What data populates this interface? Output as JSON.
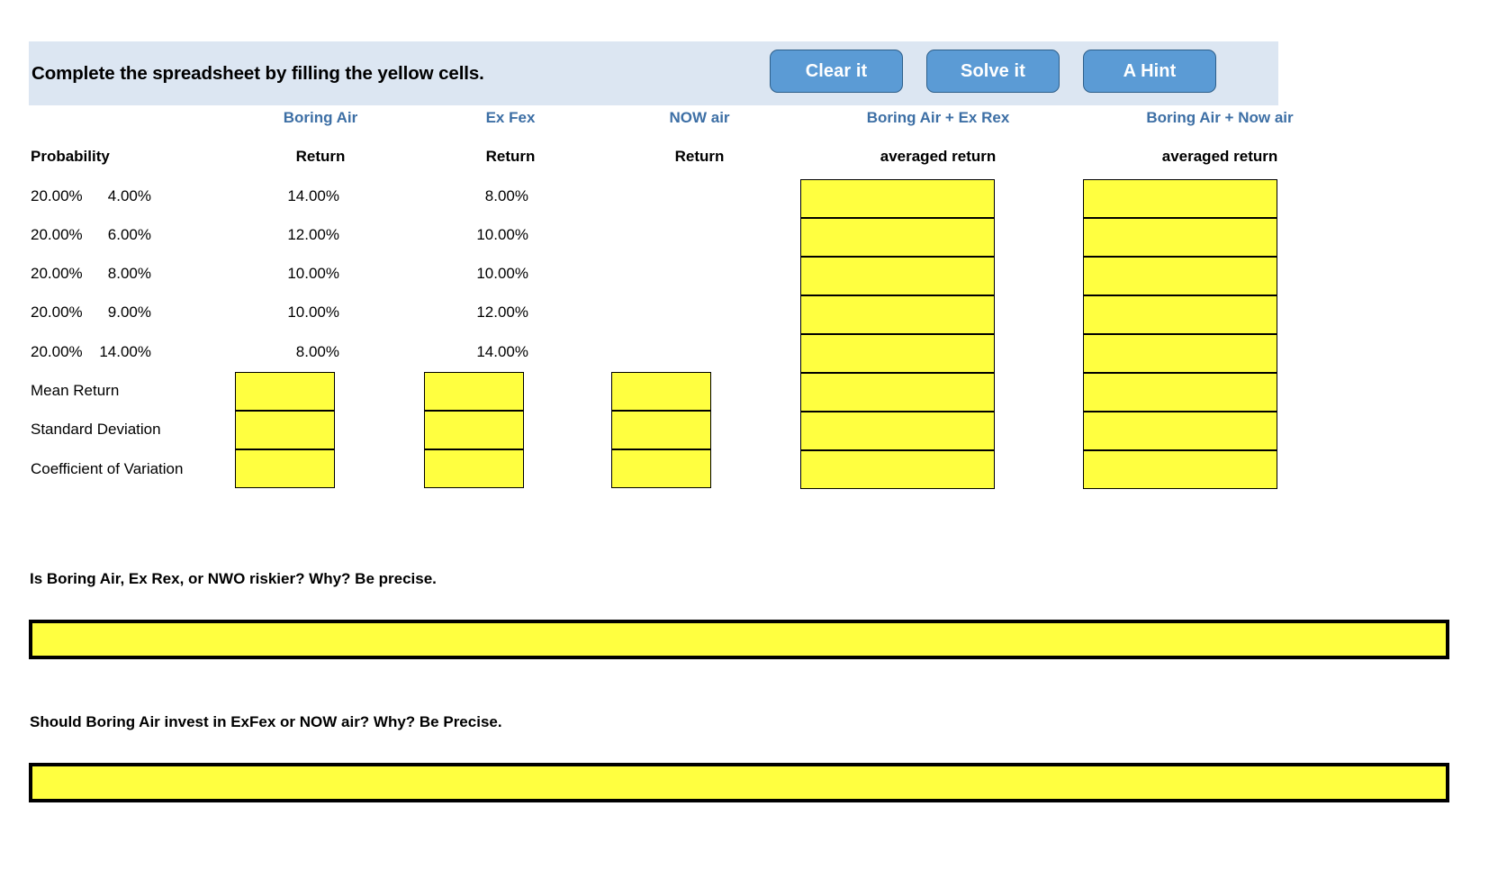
{
  "header": {
    "title": "Complete the spreadsheet by filling the yellow cells.",
    "band_color": "#dce6f2",
    "buttons": [
      {
        "label": "Clear it",
        "name": "clear-it-button"
      },
      {
        "label": "Solve it",
        "name": "solve-it-button"
      },
      {
        "label": "A Hint",
        "name": "a-hint-button"
      }
    ],
    "button_color": "#5b9bd5",
    "button_border_color": "#2e5f8a"
  },
  "table": {
    "company_headers": [
      "Boring Air",
      "Ex Fex",
      "NOW air",
      "Boring Air + Ex Rex",
      "Boring Air + Now air"
    ],
    "company_header_color": "#3d6fa5",
    "sub_headers": [
      "Probability",
      "Return",
      "Return",
      "Return",
      "averaged return",
      "averaged return"
    ],
    "rows": [
      {
        "probability": "20.00%",
        "boring_air": "4.00%",
        "ex_fex": "14.00%",
        "now_air": "8.00%"
      },
      {
        "probability": "20.00%",
        "boring_air": "6.00%",
        "ex_fex": "12.00%",
        "now_air": "10.00%"
      },
      {
        "probability": "20.00%",
        "boring_air": "8.00%",
        "ex_fex": "10.00%",
        "now_air": "10.00%"
      },
      {
        "probability": "20.00%",
        "boring_air": "9.00%",
        "ex_fex": "10.00%",
        "now_air": "12.00%"
      },
      {
        "probability": "20.00%",
        "boring_air": "14.00%",
        "ex_fex": "8.00%",
        "now_air": "14.00%"
      }
    ],
    "stat_labels": [
      "Mean Return",
      "Standard Deviation",
      "Coefficient of Variation"
    ],
    "input_cell_color": "#ffff40",
    "input_cell_border_color": "#000000"
  },
  "questions": [
    {
      "prompt": "Is Boring Air, Ex Rex, or NWO riskier? Why? Be precise.",
      "answer": ""
    },
    {
      "prompt": "Should Boring Air invest in ExFex or NOW air? Why? Be Precise.",
      "answer": ""
    }
  ],
  "chart_data": {
    "type": "table",
    "title": "Complete the spreadsheet by filling the yellow cells.",
    "categories": [
      "20.00%",
      "20.00%",
      "20.00%",
      "20.00%",
      "20.00%"
    ],
    "xlabel": "Probability",
    "ylabel": "Return",
    "series": [
      {
        "name": "Boring Air",
        "values": [
          4.0,
          6.0,
          8.0,
          9.0,
          14.0
        ]
      },
      {
        "name": "Ex Fex",
        "values": [
          14.0,
          12.0,
          10.0,
          10.0,
          8.0
        ]
      },
      {
        "name": "NOW air",
        "values": [
          8.0,
          10.0,
          10.0,
          12.0,
          14.0
        ]
      },
      {
        "name": "Boring Air + Ex Rex",
        "values": [
          null,
          null,
          null,
          null,
          null
        ]
      },
      {
        "name": "Boring Air + Now air",
        "values": [
          null,
          null,
          null,
          null,
          null
        ]
      }
    ],
    "computed_rows": [
      "Mean Return",
      "Standard Deviation",
      "Coefficient of Variation"
    ]
  }
}
